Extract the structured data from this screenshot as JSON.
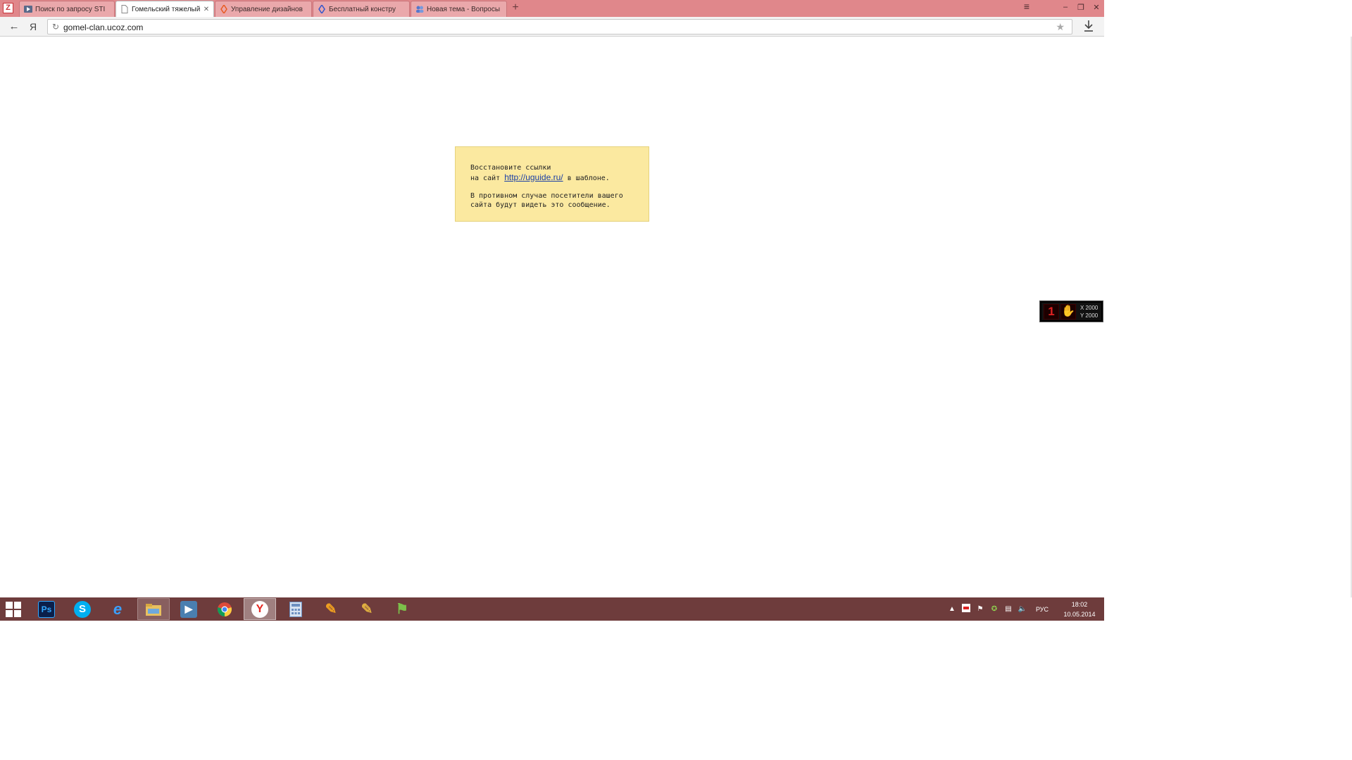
{
  "browser": {
    "logo_letter": "Z",
    "tabs": [
      {
        "title": "Поиск по запросу STI",
        "favicon": "video-icon",
        "active": false
      },
      {
        "title": "Гомельский тяжелый",
        "favicon": "page-icon",
        "active": true
      },
      {
        "title": "Управление дизайнов",
        "favicon": "ucoz-icon",
        "active": false
      },
      {
        "title": "Бесплатный констру",
        "favicon": "ucoz-blue-icon",
        "active": false
      },
      {
        "title": "Новая тема - Вопросы",
        "favicon": "forum-users-icon",
        "active": false
      }
    ],
    "new_tab_symbol": "+",
    "url": "gomel-clan.ucoz.com",
    "yandex_letter": "Я"
  },
  "notice": {
    "line1": "Восстановите ссылки",
    "line2_prefix": "на сайт",
    "link_text": "http://uguide.ru/",
    "line2_suffix": "в шаблоне.",
    "line3": "В противном случае посетители вашего",
    "line4": "сайта будут видеть это сообщение."
  },
  "mouse_widget": {
    "badge": "1",
    "x_label": "X 2000",
    "y_label": "Y 2000"
  },
  "taskbar": {
    "apps": [
      {
        "name": "photoshop",
        "label": "Ps",
        "color": "#0b1f4a",
        "fg": "#31a8ff"
      },
      {
        "name": "skype",
        "label": "S",
        "color": "#00aff0",
        "fg": "#ffffff"
      },
      {
        "name": "internet-explorer",
        "label": "e",
        "color": "#1e90e0",
        "fg": "#ffffff"
      },
      {
        "name": "file-explorer",
        "label": "",
        "color": "#e8c060",
        "fg": "#ffffff"
      },
      {
        "name": "media-player",
        "label": "▶",
        "color": "#4a7fb0",
        "fg": "#ffffff"
      },
      {
        "name": "chrome",
        "label": "",
        "color": "#dd4b39",
        "fg": "#ffffff"
      },
      {
        "name": "yandex-browser",
        "label": "Y",
        "color": "#ffffff",
        "fg": "#e52620"
      },
      {
        "name": "calculator",
        "label": "",
        "color": "#6d8fc0",
        "fg": "#ffffff"
      },
      {
        "name": "pencil-app",
        "label": "✎",
        "color": "transparent",
        "fg": "#f0a020"
      },
      {
        "name": "brush-app",
        "label": "✎",
        "color": "transparent",
        "fg": "#e0b040"
      },
      {
        "name": "flag-app",
        "label": "⚑",
        "color": "transparent",
        "fg": "#7cc04a"
      }
    ],
    "language": "РУС",
    "time": "18:02",
    "date": "10.05.2014"
  }
}
